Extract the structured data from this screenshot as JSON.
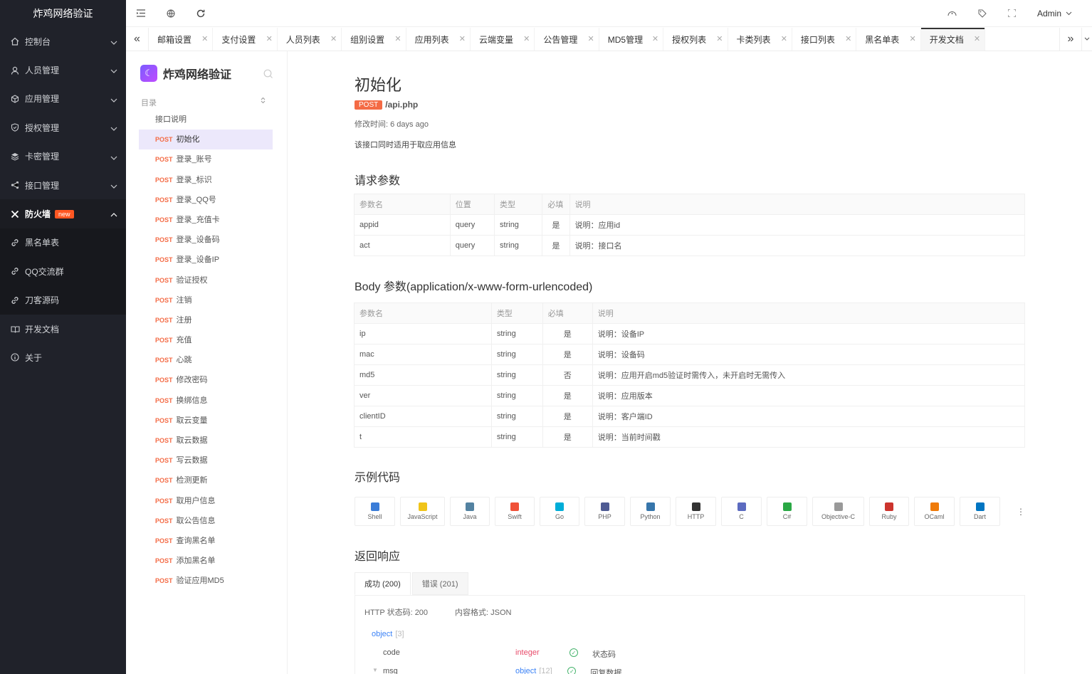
{
  "app": {
    "name": "炸鸡网络验证"
  },
  "sidebar": {
    "items": [
      {
        "label": "控制台",
        "icon": "home-icon"
      },
      {
        "label": "人员管理",
        "icon": "user-icon"
      },
      {
        "label": "应用管理",
        "icon": "cube-icon"
      },
      {
        "label": "授权管理",
        "icon": "shield-icon"
      },
      {
        "label": "卡密管理",
        "icon": "layers-icon"
      },
      {
        "label": "接口管理",
        "icon": "share-icon"
      },
      {
        "label": "防火墙",
        "icon": "tools-icon",
        "badge": "new"
      },
      {
        "label": "黑名单表",
        "icon": "link-icon"
      },
      {
        "label": "QQ交流群",
        "icon": "link-icon"
      },
      {
        "label": "刀客源码",
        "icon": "link-icon"
      },
      {
        "label": "开发文档",
        "icon": "book-icon"
      },
      {
        "label": "关于",
        "icon": "info-icon"
      }
    ]
  },
  "topbar": {
    "user": "Admin"
  },
  "tabs": [
    {
      "label": "邮箱设置"
    },
    {
      "label": "支付设置"
    },
    {
      "label": "人员列表"
    },
    {
      "label": "组别设置"
    },
    {
      "label": "应用列表"
    },
    {
      "label": "云端变量"
    },
    {
      "label": "公告管理"
    },
    {
      "label": "MD5管理"
    },
    {
      "label": "授权列表"
    },
    {
      "label": "卡类列表"
    },
    {
      "label": "接口列表"
    },
    {
      "label": "黑名单表"
    },
    {
      "label": "开发文档"
    }
  ],
  "doc_nav": {
    "toc_label": "目录",
    "intro": "接口说明",
    "method": "POST",
    "items": [
      "初始化",
      "登录_账号",
      "登录_标识",
      "登录_QQ号",
      "登录_充值卡",
      "登录_设备码",
      "登录_设备IP",
      "验证授权",
      "注销",
      "注册",
      "充值",
      "心跳",
      "修改密码",
      "换绑信息",
      "取云变量",
      "取云数据",
      "写云数据",
      "检测更新",
      "取用户信息",
      "取公告信息",
      "查询黑名单",
      "添加黑名单",
      "验证应用MD5"
    ]
  },
  "doc": {
    "title": "初始化",
    "method": "POST",
    "path": "/api.php",
    "modified": "修改时间: 6 days ago",
    "description": "该接口同时适用于取应用信息",
    "query_title": "请求参数",
    "query_headers": [
      "参数名",
      "位置",
      "类型",
      "必填",
      "说明"
    ],
    "query_rows": [
      [
        "appid",
        "query",
        "string",
        "是",
        "说明：应用id"
      ],
      [
        "act",
        "query",
        "string",
        "是",
        "说明：接口名"
      ]
    ],
    "body_title": "Body 参数(application/x-www-form-urlencoded)",
    "body_headers": [
      "参数名",
      "类型",
      "必填",
      "说明"
    ],
    "body_rows": [
      [
        "ip",
        "string",
        "是",
        "说明：设备IP"
      ],
      [
        "mac",
        "string",
        "是",
        "说明：设备码"
      ],
      [
        "md5",
        "string",
        "否",
        "说明：应用开启md5验证时需传入，未开启时无需传入"
      ],
      [
        "ver",
        "string",
        "是",
        "说明：应用版本"
      ],
      [
        "clientID",
        "string",
        "是",
        "说明：客户端ID"
      ],
      [
        "t",
        "string",
        "是",
        "说明：当前时间戳"
      ]
    ],
    "code_title": "示例代码",
    "languages": [
      {
        "label": "Shell",
        "color": "#3b7dd8"
      },
      {
        "label": "JavaScript",
        "color": "#f0c419"
      },
      {
        "label": "Java",
        "color": "#5382a1"
      },
      {
        "label": "Swift",
        "color": "#f05138"
      },
      {
        "label": "Go",
        "color": "#00add8"
      },
      {
        "label": "PHP",
        "color": "#4f5b93"
      },
      {
        "label": "Python",
        "color": "#3776ab"
      },
      {
        "label": "HTTP",
        "color": "#333333"
      },
      {
        "label": "C",
        "color": "#5c6bc0"
      },
      {
        "label": "C#",
        "color": "#2aa845"
      },
      {
        "label": "Objective-C",
        "color": "#999999"
      },
      {
        "label": "Ruby",
        "color": "#cc342d"
      },
      {
        "label": "OCaml",
        "color": "#ef7a08"
      },
      {
        "label": "Dart",
        "color": "#0175c2"
      }
    ],
    "more": "⋮",
    "response_title": "返回响应",
    "response_tabs": [
      "成功 (200)",
      "错误 (201)"
    ],
    "http_status": "HTTP 状态码: 200",
    "content_type": "内容格式: JSON",
    "schema": {
      "root": "object",
      "root_count": "[3]",
      "fields": [
        {
          "name": "code",
          "type": "integer",
          "desc": "状态码"
        },
        {
          "name": "msg",
          "type": "object",
          "count": "[12]",
          "desc": "回复数据"
        }
      ]
    }
  }
}
